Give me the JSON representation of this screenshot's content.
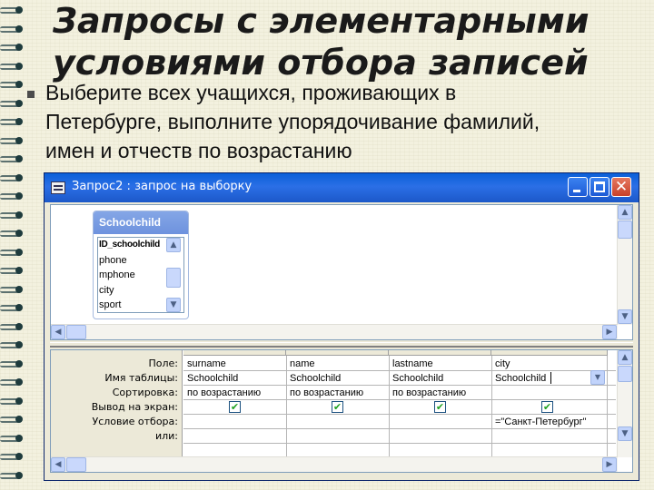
{
  "slide": {
    "title_lines": [
      "Запросы с элементарными",
      "условиями отбора записей"
    ],
    "bullet_lines": [
      "Выберите всех учащихся, проживающих в",
      "Петербурге, выполните упорядочивание фамилий,",
      "имен и отчеств по возрастанию"
    ]
  },
  "window": {
    "title": "Запрос2 : запрос на выборку",
    "close_glyph": "✕"
  },
  "table": {
    "name": "Schoolchild",
    "fields": [
      "ID_schoolchild",
      "phone",
      "mphone",
      "city",
      "sport"
    ]
  },
  "grid": {
    "row_labels": [
      "Поле:",
      "Имя таблицы:",
      "Сортировка:",
      "Вывод на экран:",
      "Условие отбора:",
      "или:"
    ],
    "columns": [
      {
        "field": "surname",
        "table": "Schoolchild",
        "sort": "по возрастанию",
        "show": true,
        "criteria": ""
      },
      {
        "field": "name",
        "table": "Schoolchild",
        "sort": "по возрастанию",
        "show": true,
        "criteria": ""
      },
      {
        "field": "lastname",
        "table": "Schoolchild",
        "sort": "по возрастанию",
        "show": true,
        "criteria": ""
      },
      {
        "field": "city",
        "table": "Schoolchild",
        "sort": "",
        "show": true,
        "criteria": "=\"Санкт-Петербург\""
      }
    ],
    "check_glyph": "✔"
  },
  "icons": {
    "scroll_up": "▲",
    "scroll_down": "▼",
    "scroll_left": "◀",
    "scroll_right": "▶",
    "dropdown": "▼"
  },
  "colors": {
    "titlebar": "#0a5fd8",
    "table_header": "#7a9de2",
    "close_button": "#c8412a",
    "checkbox_check": "#21a121"
  }
}
